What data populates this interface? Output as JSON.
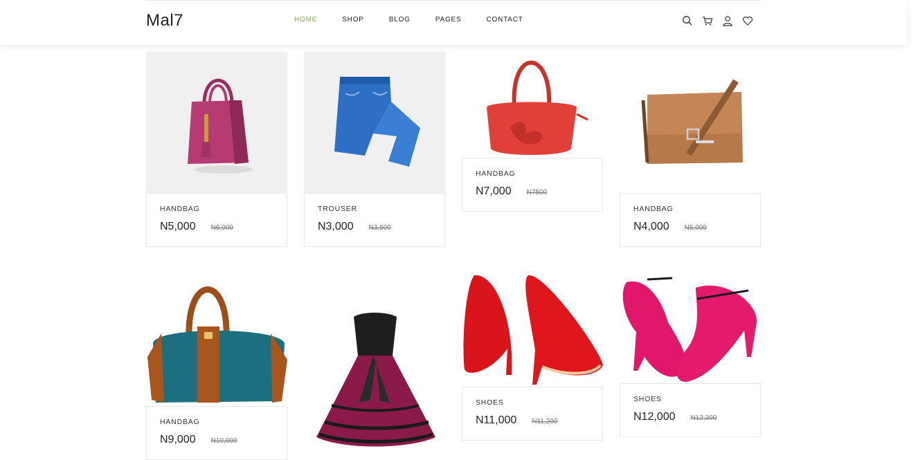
{
  "header": {
    "logo": "Mal7",
    "nav": [
      "HOME",
      "SHOP",
      "BLOG",
      "PAGES",
      "CONTACT"
    ],
    "active_nav": "HOME",
    "icons": [
      "search-icon",
      "cart-icon",
      "user-icon",
      "heart-icon"
    ],
    "accent_color": "#7cb342"
  },
  "products": [
    {
      "category": "HANDBAG",
      "price": "N5,000",
      "old_price": "N6,000",
      "image": "pink-handbag"
    },
    {
      "category": "TROUSER",
      "price": "N3,000",
      "old_price": "N3,500",
      "image": "blue-jeans"
    },
    {
      "category": "HANDBAG",
      "price": "N7,000",
      "old_price": "N7500",
      "image": "red-handbag"
    },
    {
      "category": "HANDBAG",
      "price": "N4,000",
      "old_price": "N5,000",
      "image": "brown-messenger-bag"
    },
    {
      "category": "HANDBAG",
      "price": "N9,000",
      "old_price": "N10,000",
      "image": "teal-brown-handbag"
    },
    {
      "category": "",
      "price": "",
      "old_price": "",
      "image": "black-pink-dress"
    },
    {
      "category": "SHOES",
      "price": "N11,000",
      "old_price": "N11,200",
      "image": "red-heels"
    },
    {
      "category": "SHOES",
      "price": "N12,000",
      "old_price": "N12,300",
      "image": "pink-heels"
    }
  ]
}
